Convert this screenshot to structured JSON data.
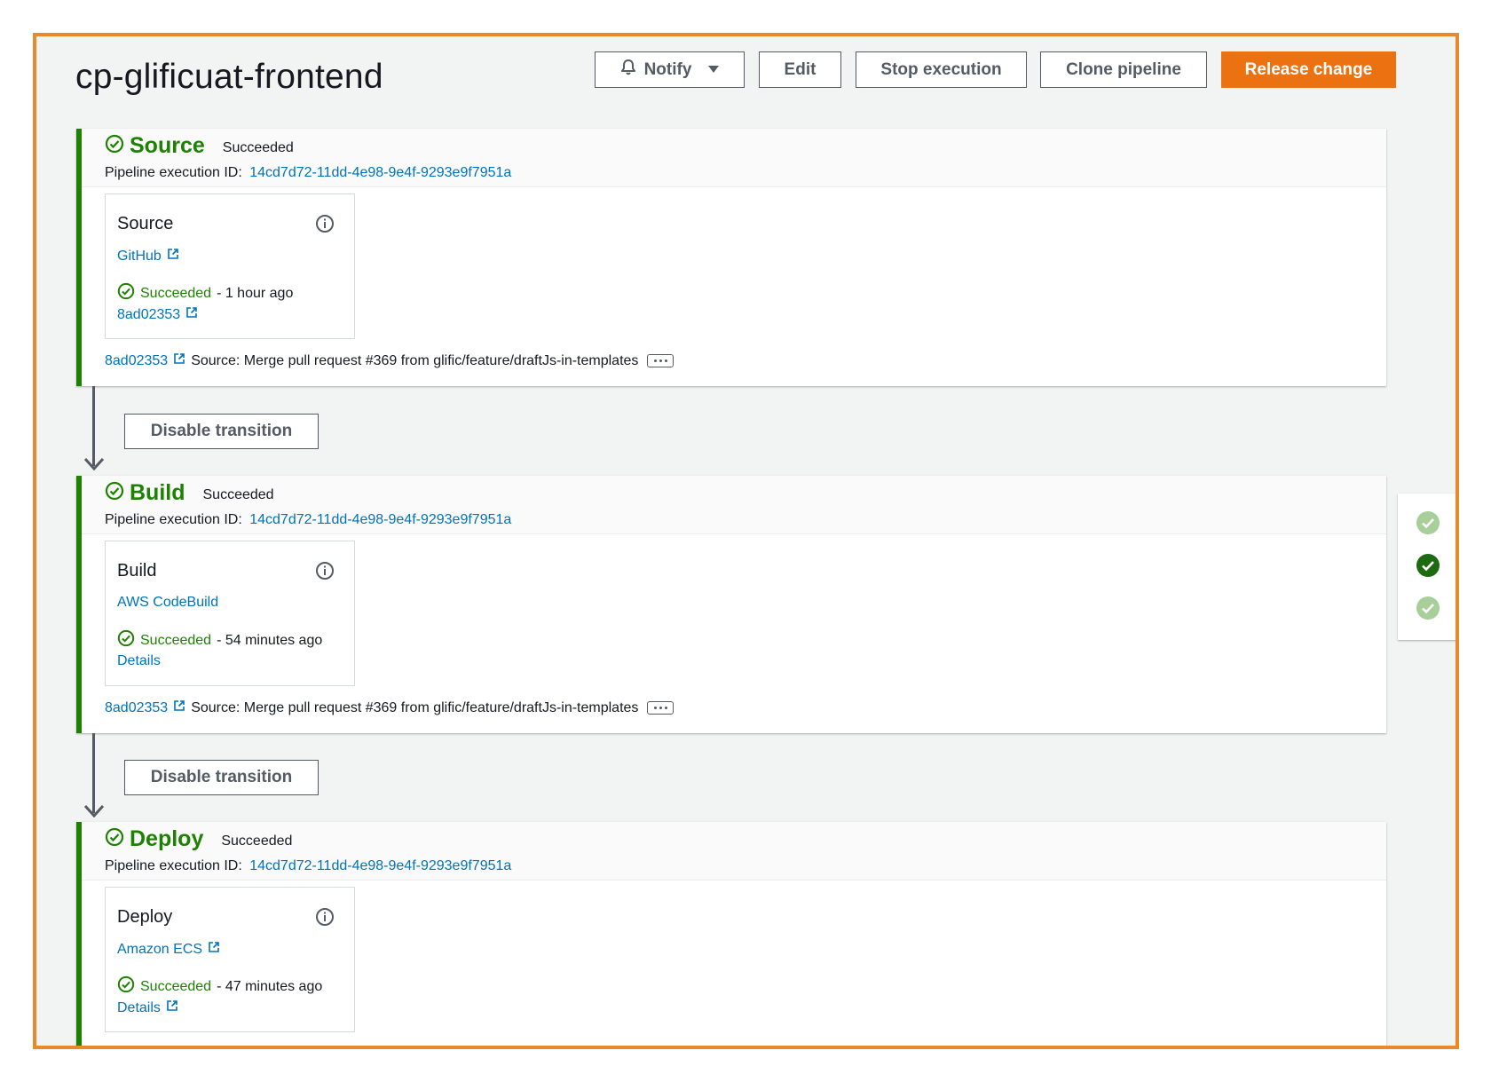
{
  "pipeline": {
    "title": "cp-glificuat-frontend"
  },
  "toolbar": {
    "notify_label": "Notify",
    "edit_label": "Edit",
    "stop_label": "Stop execution",
    "clone_label": "Clone pipeline",
    "release_label": "Release change"
  },
  "stages": [
    {
      "name": "Source",
      "status": "Succeeded",
      "exec_label": "Pipeline execution ID:",
      "exec_id": "14cd7d72-11dd-4e98-9e4f-9293e9f7951a",
      "action": {
        "name": "Source",
        "provider": "GitHub",
        "status": "Succeeded",
        "time": "- 1 hour ago",
        "extra": "8ad02353"
      },
      "revision": {
        "id": "8ad02353",
        "message": "Source: Merge pull request #369 from glific/feature/draftJs-in-templates"
      }
    },
    {
      "name": "Build",
      "status": "Succeeded",
      "exec_label": "Pipeline execution ID:",
      "exec_id": "14cd7d72-11dd-4e98-9e4f-9293e9f7951a",
      "action": {
        "name": "Build",
        "provider": "AWS CodeBuild",
        "status": "Succeeded",
        "time": "- 54 minutes ago",
        "extra": "Details"
      },
      "revision": {
        "id": "8ad02353",
        "message": "Source: Merge pull request #369 from glific/feature/draftJs-in-templates"
      }
    },
    {
      "name": "Deploy",
      "status": "Succeeded",
      "exec_label": "Pipeline execution ID:",
      "exec_id": "14cd7d72-11dd-4e98-9e4f-9293e9f7951a",
      "action": {
        "name": "Deploy",
        "provider": "Amazon ECS",
        "status": "Succeeded",
        "time": "- 47 minutes ago",
        "extra": "Details"
      }
    }
  ],
  "transitions": [
    {
      "label": "Disable transition"
    },
    {
      "label": "Disable transition"
    }
  ],
  "colors": {
    "success": "#1d8102",
    "link": "#0073bb",
    "primary": "#ec7211",
    "frame": "#e8892b"
  },
  "icons": [
    "bell-icon",
    "caret-down-icon",
    "check-circle-icon",
    "info-icon",
    "external-link-icon",
    "ellipsis-icon",
    "arrow-down-icon"
  ]
}
